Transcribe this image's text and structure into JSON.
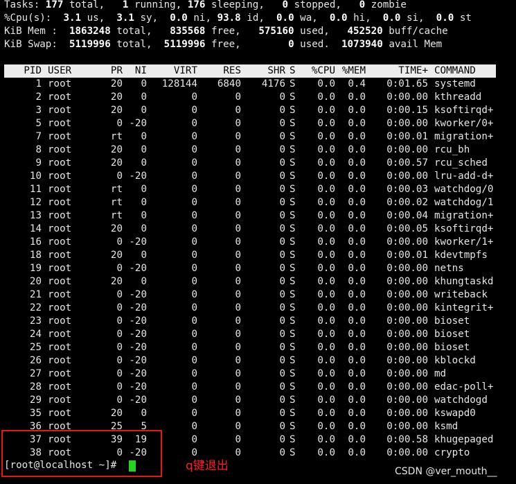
{
  "summary": {
    "tasks": {
      "label": "Tasks:",
      "total": "177",
      "total_lbl": "total,",
      "running": "1",
      "running_lbl": "running,",
      "sleeping": "176",
      "sleeping_lbl": "sleeping,",
      "stopped": "0",
      "stopped_lbl": "stopped,",
      "zombie": "0",
      "zombie_lbl": "zombie"
    },
    "cpu": {
      "label": "%Cpu(s):",
      "us": "3.1",
      "us_lbl": "us,",
      "sy": "3.1",
      "sy_lbl": "sy,",
      "ni": "0.0",
      "ni_lbl": "ni,",
      "id": "93.8",
      "id_lbl": "id,",
      "wa": "0.0",
      "wa_lbl": "wa,",
      "hi": "0.0",
      "hi_lbl": "hi,",
      "si": "0.0",
      "si_lbl": "si,",
      "st": "0.0",
      "st_lbl": "st"
    },
    "mem": {
      "label": "KiB Mem :",
      "total": "1863248",
      "total_lbl": "total,",
      "free": "835568",
      "free_lbl": "free,",
      "used": "575160",
      "used_lbl": "used,",
      "buff": "452520",
      "buff_lbl": "buff/cache"
    },
    "swap": {
      "label": "KiB Swap:",
      "total": "5119996",
      "total_lbl": "total,",
      "free": "5119996",
      "free_lbl": "free,",
      "used": "0",
      "used_lbl": "used.",
      "avail": "1073940",
      "avail_lbl": "avail Mem"
    }
  },
  "columns": [
    "PID",
    "USER",
    "PR",
    "NI",
    "VIRT",
    "RES",
    "SHR",
    "S",
    "%CPU",
    "%MEM",
    "TIME+",
    "COMMAND"
  ],
  "processes": [
    [
      "1",
      "root",
      "20",
      "0",
      "128144",
      "6840",
      "4176",
      "S",
      "0.0",
      "0.4",
      "0:01.65",
      "systemd"
    ],
    [
      "2",
      "root",
      "20",
      "0",
      "0",
      "0",
      "0",
      "S",
      "0.0",
      "0.0",
      "0:00.00",
      "kthreadd"
    ],
    [
      "3",
      "root",
      "20",
      "0",
      "0",
      "0",
      "0",
      "S",
      "0.0",
      "0.0",
      "0:00.15",
      "ksoftirqd+"
    ],
    [
      "5",
      "root",
      "0",
      "-20",
      "0",
      "0",
      "0",
      "S",
      "0.0",
      "0.0",
      "0:00.00",
      "kworker/0+"
    ],
    [
      "7",
      "root",
      "rt",
      "0",
      "0",
      "0",
      "0",
      "S",
      "0.0",
      "0.0",
      "0:00.01",
      "migration+"
    ],
    [
      "8",
      "root",
      "20",
      "0",
      "0",
      "0",
      "0",
      "S",
      "0.0",
      "0.0",
      "0:00.00",
      "rcu_bh"
    ],
    [
      "9",
      "root",
      "20",
      "0",
      "0",
      "0",
      "0",
      "S",
      "0.0",
      "0.0",
      "0:00.57",
      "rcu_sched"
    ],
    [
      "10",
      "root",
      "0",
      "-20",
      "0",
      "0",
      "0",
      "S",
      "0.0",
      "0.0",
      "0:00.00",
      "lru-add-d+"
    ],
    [
      "11",
      "root",
      "rt",
      "0",
      "0",
      "0",
      "0",
      "S",
      "0.0",
      "0.0",
      "0:00.03",
      "watchdog/0"
    ],
    [
      "12",
      "root",
      "rt",
      "0",
      "0",
      "0",
      "0",
      "S",
      "0.0",
      "0.0",
      "0:00.02",
      "watchdog/1"
    ],
    [
      "13",
      "root",
      "rt",
      "0",
      "0",
      "0",
      "0",
      "S",
      "0.0",
      "0.0",
      "0:00.04",
      "migration+"
    ],
    [
      "14",
      "root",
      "20",
      "0",
      "0",
      "0",
      "0",
      "S",
      "0.0",
      "0.0",
      "0:00.05",
      "ksoftirqd+"
    ],
    [
      "16",
      "root",
      "0",
      "-20",
      "0",
      "0",
      "0",
      "S",
      "0.0",
      "0.0",
      "0:00.00",
      "kworker/1+"
    ],
    [
      "18",
      "root",
      "20",
      "0",
      "0",
      "0",
      "0",
      "S",
      "0.0",
      "0.0",
      "0:00.01",
      "kdevtmpfs"
    ],
    [
      "19",
      "root",
      "0",
      "-20",
      "0",
      "0",
      "0",
      "S",
      "0.0",
      "0.0",
      "0:00.00",
      "netns"
    ],
    [
      "20",
      "root",
      "20",
      "0",
      "0",
      "0",
      "0",
      "S",
      "0.0",
      "0.0",
      "0:00.00",
      "khungtaskd"
    ],
    [
      "21",
      "root",
      "0",
      "-20",
      "0",
      "0",
      "0",
      "S",
      "0.0",
      "0.0",
      "0:00.00",
      "writeback"
    ],
    [
      "22",
      "root",
      "0",
      "-20",
      "0",
      "0",
      "0",
      "S",
      "0.0",
      "0.0",
      "0:00.00",
      "kintegrit+"
    ],
    [
      "23",
      "root",
      "0",
      "-20",
      "0",
      "0",
      "0",
      "S",
      "0.0",
      "0.0",
      "0:00.00",
      "bioset"
    ],
    [
      "24",
      "root",
      "0",
      "-20",
      "0",
      "0",
      "0",
      "S",
      "0.0",
      "0.0",
      "0:00.00",
      "bioset"
    ],
    [
      "25",
      "root",
      "0",
      "-20",
      "0",
      "0",
      "0",
      "S",
      "0.0",
      "0.0",
      "0:00.00",
      "bioset"
    ],
    [
      "26",
      "root",
      "0",
      "-20",
      "0",
      "0",
      "0",
      "S",
      "0.0",
      "0.0",
      "0:00.00",
      "kblockd"
    ],
    [
      "27",
      "root",
      "0",
      "-20",
      "0",
      "0",
      "0",
      "S",
      "0.0",
      "0.0",
      "0:00.00",
      "md"
    ],
    [
      "28",
      "root",
      "0",
      "-20",
      "0",
      "0",
      "0",
      "S",
      "0.0",
      "0.0",
      "0:00.00",
      "edac-poll+"
    ],
    [
      "29",
      "root",
      "0",
      "-20",
      "0",
      "0",
      "0",
      "S",
      "0.0",
      "0.0",
      "0:00.00",
      "watchdogd"
    ],
    [
      "35",
      "root",
      "20",
      "0",
      "0",
      "0",
      "0",
      "S",
      "0.0",
      "0.0",
      "0:00.00",
      "kswapd0"
    ],
    [
      "36",
      "root",
      "25",
      "5",
      "0",
      "0",
      "0",
      "S",
      "0.0",
      "0.0",
      "0:00.00",
      "ksmd"
    ],
    [
      "37",
      "root",
      "39",
      "19",
      "0",
      "0",
      "0",
      "S",
      "0.0",
      "0.0",
      "0:00.58",
      "khugepaged"
    ],
    [
      "38",
      "root",
      "0",
      "-20",
      "0",
      "0",
      "0",
      "S",
      "0.0",
      "0.0",
      "0:00.00",
      "crypto"
    ]
  ],
  "prompt": {
    "text": "[root@localhost ~]#"
  },
  "annotation": {
    "text": "q键退出",
    "color": "#ff1f1f"
  },
  "watermark": {
    "text": "CSDN @ver_mouth__"
  },
  "colors": {
    "background": "#000000",
    "text": "#e6e6e6",
    "header_bar": "#ececec",
    "cursor": "#22d41f",
    "highlight_box": "#e8151b"
  }
}
